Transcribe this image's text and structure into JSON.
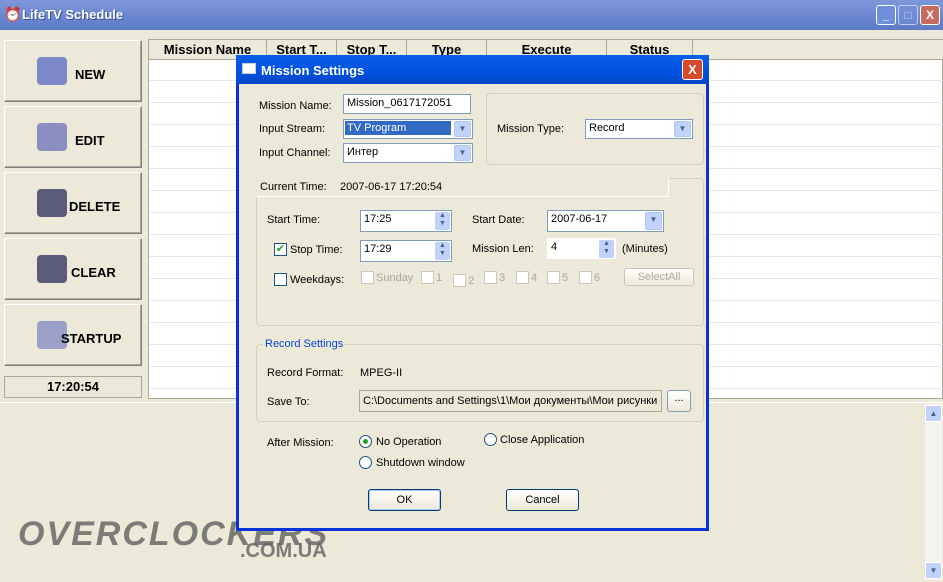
{
  "window": {
    "title": "LifeTV Schedule",
    "minimize": "_",
    "maximize": "□",
    "close": "X"
  },
  "sidebar": {
    "buttons": [
      {
        "label": "NEW",
        "icon": "new-folder-icon"
      },
      {
        "label": "EDIT",
        "icon": "edit-folder-icon"
      },
      {
        "label": "DELETE",
        "icon": "delete-camera-icon"
      },
      {
        "label": "CLEAR",
        "icon": "clear-camera-icon"
      },
      {
        "label": "STARTUP",
        "icon": "startup-icon"
      }
    ],
    "clock": "17:20:54"
  },
  "table": {
    "columns": [
      "Mission Name",
      "Start T...",
      "Stop T...",
      "Type",
      "Execute",
      "Status"
    ]
  },
  "watermark": {
    "text": "OVERCLOCKERS",
    "sub": ".COM.UA"
  },
  "dialog": {
    "title": "Mission Settings",
    "close": "X",
    "mission_name_label": "Mission Name:",
    "mission_name": "Mission_0617172051",
    "input_stream_label": "Input Stream:",
    "input_stream": "TV Program",
    "input_channel_label": "Input Channel:",
    "input_channel": "Интер",
    "mission_type_label": "Mission Type:",
    "mission_type": "Record",
    "current_time_label": "Current Time:",
    "current_time": "2007-06-17 17:20:54",
    "start_time_label": "Start Time:",
    "start_time": "17:25",
    "start_date_label": "Start Date:",
    "start_date": "2007-06-17",
    "stop_time_label": "Stop Time:",
    "stop_time": "17:29",
    "stop_time_checked": true,
    "mission_len_label": "Mission Len:",
    "mission_len": "4",
    "minutes_label": "(Minutes)",
    "weekdays_label": "Weekdays:",
    "weekdays_checked": false,
    "days": [
      "Sunday",
      "1",
      "2",
      "3",
      "4",
      "5",
      "6"
    ],
    "select_all": "SelectAll",
    "record_settings_label": "Record Settings",
    "record_format_label": "Record Format:",
    "record_format": "MPEG-II",
    "save_to_label": "Save To:",
    "save_to": "C:\\Documents and Settings\\1\\Мои документы\\Мои рисунки",
    "browse": "...",
    "after_mission_label": "After Mission:",
    "after_options": [
      {
        "label": "No Operation",
        "selected": true
      },
      {
        "label": "Close Application",
        "selected": false
      },
      {
        "label": "Shutdown window",
        "selected": false
      }
    ],
    "ok": "OK",
    "cancel": "Cancel"
  },
  "colors": {
    "titlebar": "#6a86cf",
    "dialog_title": "#0054e3",
    "group_label": "#0046d5",
    "check": "#21a121"
  }
}
